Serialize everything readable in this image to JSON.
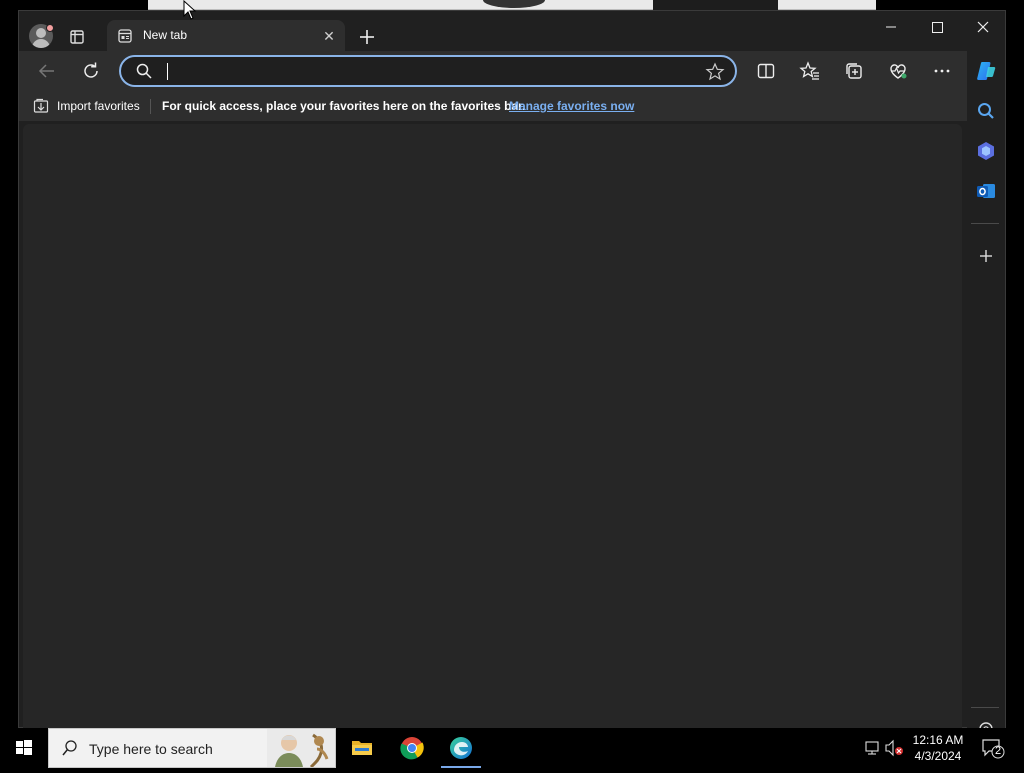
{
  "browser": {
    "tab": {
      "title": "New tab"
    },
    "address_bar": {
      "value": "",
      "placeholder": ""
    },
    "favorites_bar": {
      "import_label": "Import favorites",
      "hint": "For quick access, place your favorites here on the favorites bar.",
      "manage_link": "Manage favorites now"
    }
  },
  "taskbar": {
    "search_placeholder": "Type here to search",
    "time": "12:16 AM",
    "date": "4/3/2024",
    "notification_count": "2"
  },
  "colors": {
    "address_focus": "#8ab4e8",
    "link": "#7aaff0",
    "chrome_bg": "#2e2e2e",
    "page_bg": "#262626"
  },
  "icons": {
    "titlebar": [
      "profile-icon",
      "tab-actions-icon",
      "new-tab-page-icon",
      "close-icon",
      "plus-icon",
      "minimize-icon",
      "maximize-icon",
      "close-window-icon"
    ],
    "toolbar": [
      "back-icon",
      "refresh-icon",
      "search-icon",
      "favorite-star-icon",
      "split-screen-icon",
      "favorites-icon",
      "collections-icon",
      "browser-essentials-icon",
      "more-icon",
      "copilot-icon"
    ],
    "sidebar": [
      "sidebar-search-icon",
      "sidebar-copilot-icon",
      "outlook-icon",
      "add-icon",
      "settings-icon"
    ],
    "taskbar": [
      "windows-start-icon",
      "search-icon",
      "file-explorer-icon",
      "chrome-icon",
      "edge-icon",
      "network-icon",
      "mute-icon",
      "notification-icon"
    ]
  }
}
